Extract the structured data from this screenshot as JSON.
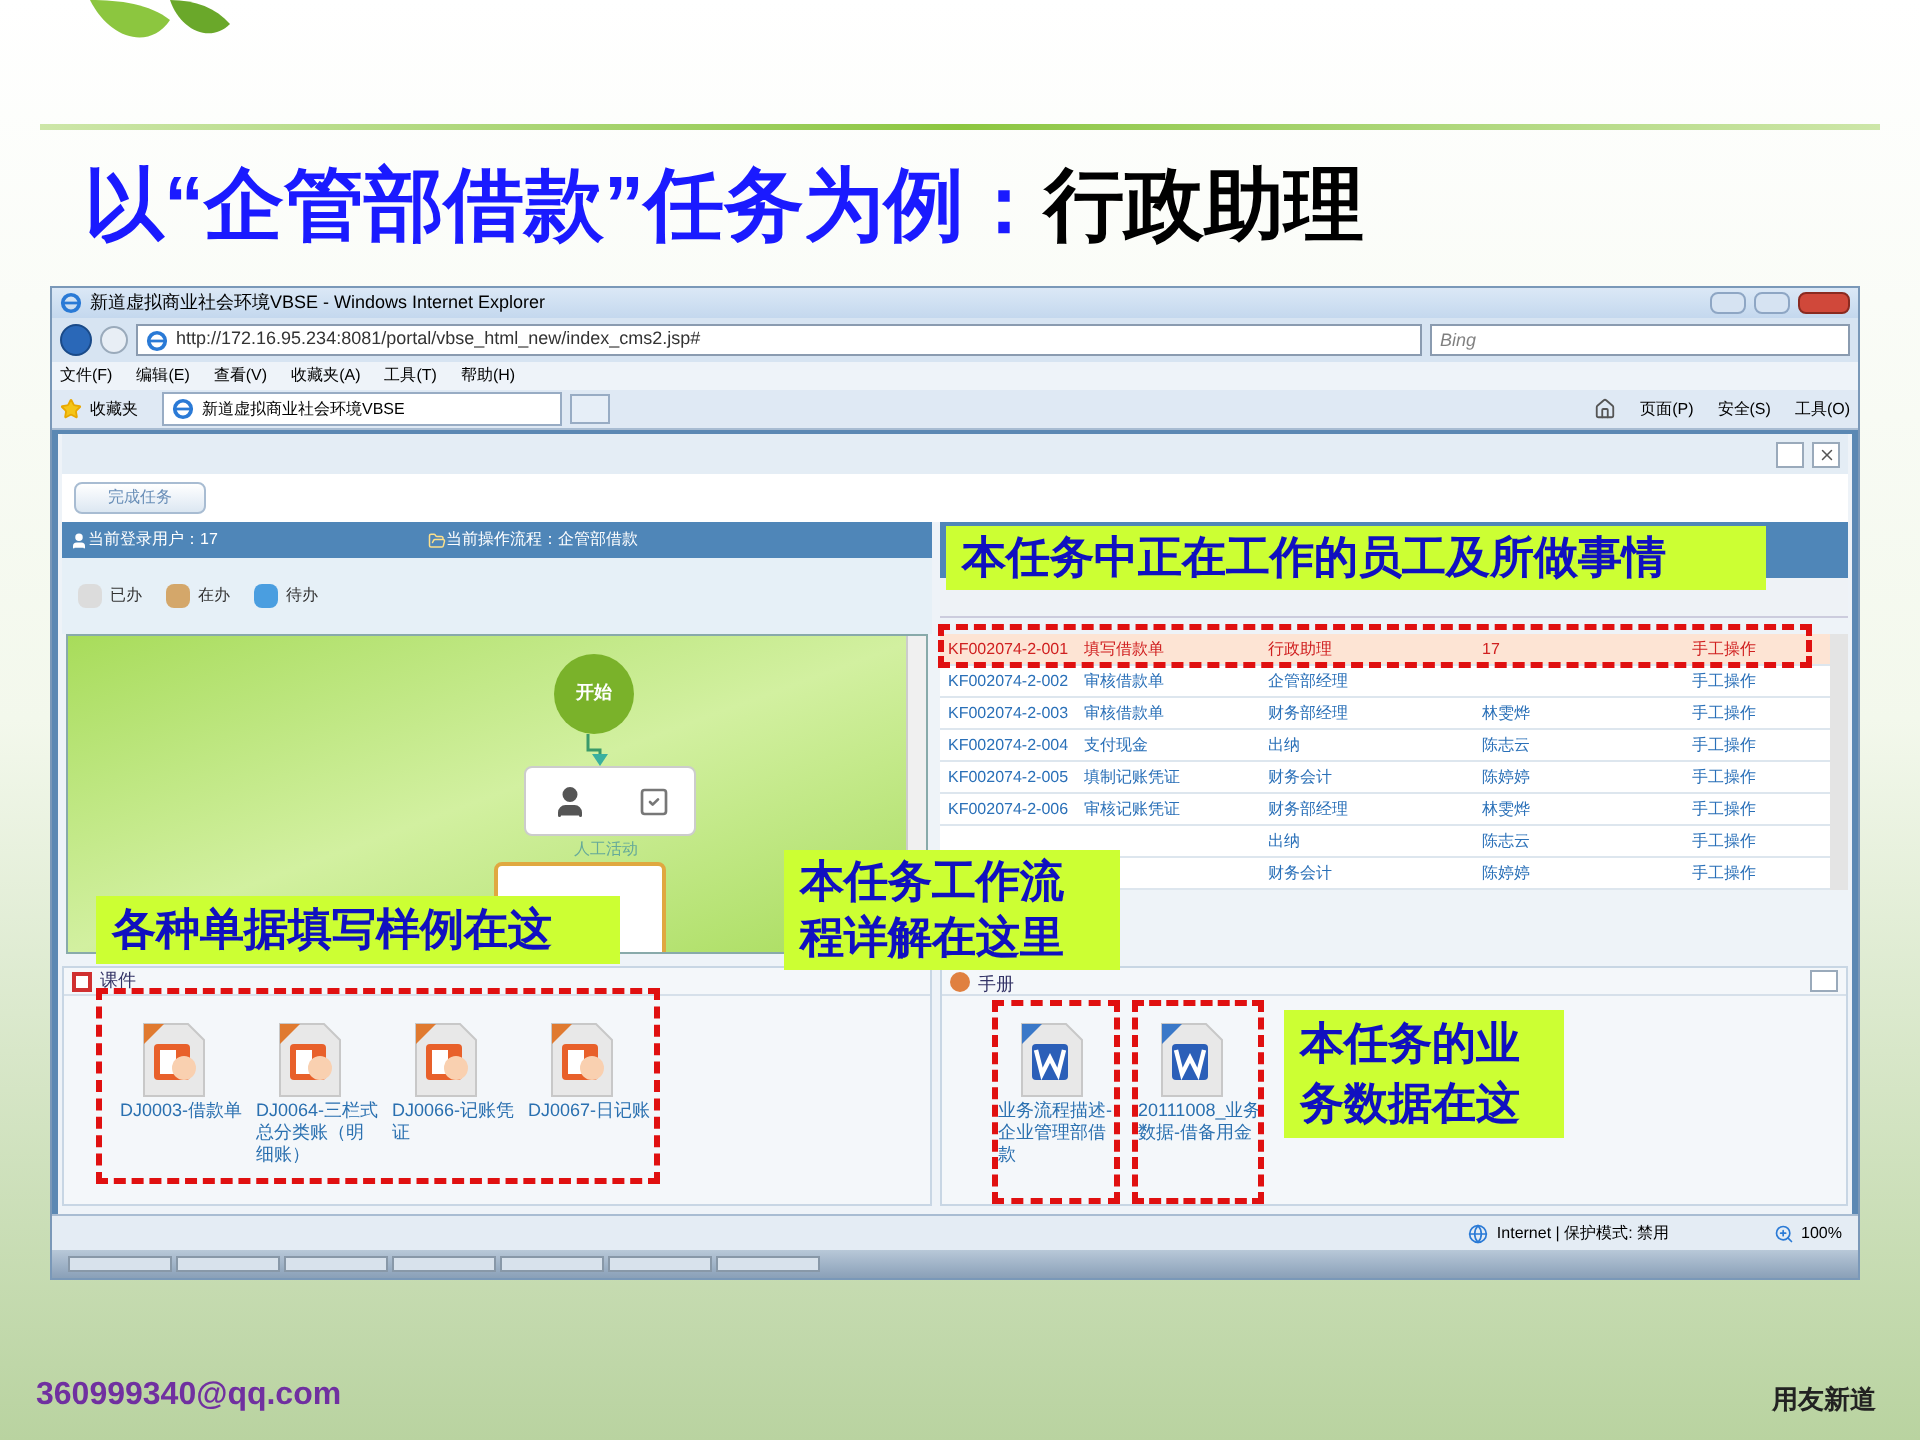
{
  "slide": {
    "title_main": "以“企管部借款”任务为例：",
    "title_role": "行政助理",
    "email": "360999340@qq.com",
    "brand": "用友新道"
  },
  "browser": {
    "title": "新道虚拟商业社会环境VBSE - Windows Internet Explorer",
    "address": "http://172.16.95.234:8081/portal/vbse_html_new/index_cms2.jsp#",
    "search_placeholder": "Bing",
    "menu": [
      "文件(F)",
      "编辑(E)",
      "查看(V)",
      "收藏夹(A)",
      "工具(T)",
      "帮助(H)"
    ],
    "favorites": "收藏夹",
    "tabs": [
      {
        "label": "新道虚拟商业社会环境VBSE",
        "selected": true
      }
    ],
    "commands": [
      "页面(P)",
      "安全(S)",
      "工具(O)"
    ],
    "status": "Internet | 保护模式: 禁用",
    "zoom": "100%"
  },
  "app": {
    "complete_button": "完成任务",
    "user": "当前登录用户：17",
    "process": "当前操作流程：企管部借款",
    "legend": [
      {
        "label": "已办",
        "color": "#dcdcdc"
      },
      {
        "label": "在办",
        "color": "#d4a76a"
      },
      {
        "label": "待办",
        "color": "#4a9ee0"
      }
    ],
    "flow": {
      "start": "开始",
      "activity": "人工活动"
    },
    "tasks": [
      {
        "id": "KF002074-2-001",
        "name": "填写借款单",
        "role": "行政助理",
        "person": "17",
        "type": "手工操作",
        "selected": true
      },
      {
        "id": "KF002074-2-002",
        "name": "审核借款单",
        "role": "企管部经理",
        "type": "手工操作",
        "selected": false
      },
      {
        "id": "KF002074-2-003",
        "name": "审核借款单",
        "role": "财务部经理",
        "person": "林雯烨",
        "type": "手工操作",
        "selected": false
      },
      {
        "id": "KF002074-2-004",
        "name": "支付现金",
        "role": "出纳",
        "person": "陈志云",
        "type": "手工操作",
        "selected": false
      },
      {
        "id": "KF002074-2-005",
        "name": "填制记账凭证",
        "role": "财务会计",
        "person": "陈婷婷",
        "type": "手工操作",
        "selected": false
      },
      {
        "id": "KF002074-2-006",
        "name": "审核记账凭证",
        "role": "财务部经理",
        "person": "林雯烨",
        "type": "手工操作",
        "selected": false
      },
      {
        "role": "出纳",
        "person": "陈志云",
        "type": "手工操作",
        "selected": false
      },
      {
        "role": "财务会计",
        "person": "陈婷婷",
        "type": "手工操作",
        "selected": false
      }
    ],
    "courseware": {
      "title": "课件",
      "files": [
        "DJ0003-借款单",
        "DJ0064-三栏式总分类账（明细账）",
        "DJ0066-记账凭证",
        "DJ0067-日记账"
      ]
    },
    "manual": {
      "title": "手册",
      "files": [
        "业务流程描述-企业管理部借款",
        "20111008_业务数据-借备用金"
      ]
    }
  },
  "callouts": [
    "本任务中正在工作的员工及所做事情",
    "各种单据填写样例在这",
    "本任务工作流程详解在这里",
    "本任务的业务数据在这"
  ]
}
